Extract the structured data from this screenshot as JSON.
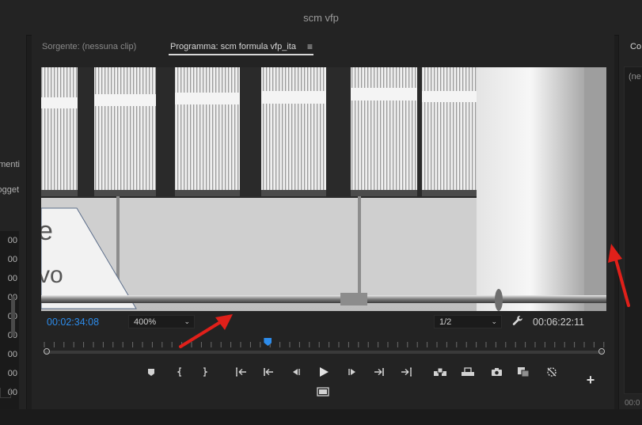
{
  "window": {
    "title": "scm vfp"
  },
  "left_panel": {
    "label_1": "menti",
    "label_2": "ogget",
    "rows": [
      "00",
      "00",
      "00",
      "00",
      "00",
      "00",
      "00",
      "00",
      "00"
    ]
  },
  "program_panel": {
    "tab_source": "Sorgente: (nessuna clip)",
    "tab_program": "Programma: scm formula vfp_ita",
    "menu_icon": "≡",
    "timecode_current": "00:02:34:08",
    "timecode_duration": "00:06:22:11",
    "zoom": {
      "value": "400%"
    },
    "resolution": {
      "value": "1/2"
    },
    "video_overlay_text": [
      "e",
      "vo"
    ],
    "playhead_position": 0.4,
    "controls": [
      "add-marker-icon",
      "mark-in-icon",
      "mark-out-icon",
      "go-to-in-icon",
      "step-back-icon",
      "play-icon",
      "step-forward-icon",
      "go-to-out-icon",
      "insert-icon",
      "overwrite-icon",
      "lift-icon",
      "extract-icon",
      "export-frame-icon",
      "comparison-view-icon",
      "multicam-icon"
    ],
    "add_button": "+"
  },
  "right_panel": {
    "tab": "Co",
    "inner_text": "(ne",
    "bottom_text": "00:0"
  },
  "annotations": {
    "arrow_color": "#e0201a"
  },
  "colors": {
    "accent": "#2d8ceb",
    "panel": "#232323",
    "background": "#1d1d1d"
  }
}
